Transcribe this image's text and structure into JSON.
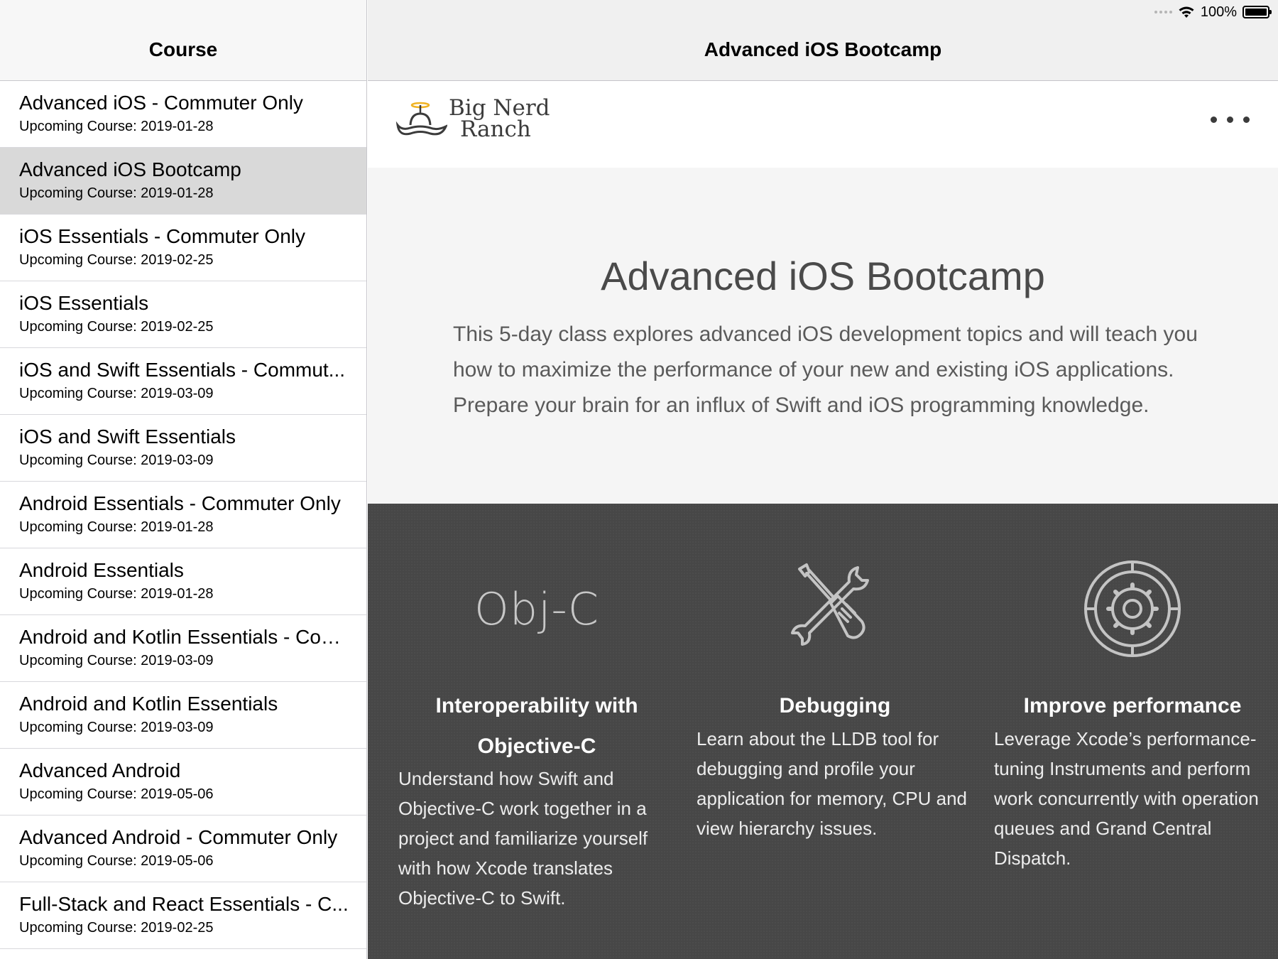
{
  "master": {
    "title": "Course",
    "courses": [
      {
        "name": "Advanced iOS - Commuter Only",
        "date": "Upcoming Course: 2019-01-28"
      },
      {
        "name": "Advanced iOS Bootcamp",
        "date": "Upcoming Course: 2019-01-28",
        "selected": true
      },
      {
        "name": "iOS Essentials - Commuter Only",
        "date": "Upcoming Course: 2019-02-25"
      },
      {
        "name": "iOS Essentials",
        "date": "Upcoming Course: 2019-02-25"
      },
      {
        "name": "iOS and Swift Essentials - Commut...",
        "date": "Upcoming Course: 2019-03-09"
      },
      {
        "name": "iOS and Swift Essentials",
        "date": "Upcoming Course: 2019-03-09"
      },
      {
        "name": "Android Essentials - Commuter Only",
        "date": "Upcoming Course: 2019-01-28"
      },
      {
        "name": "Android Essentials",
        "date": "Upcoming Course: 2019-01-28"
      },
      {
        "name": "Android and Kotlin Essentials - Com...",
        "date": "Upcoming Course: 2019-03-09"
      },
      {
        "name": "Android and Kotlin Essentials",
        "date": "Upcoming Course: 2019-03-09"
      },
      {
        "name": "Advanced Android",
        "date": "Upcoming Course: 2019-05-06"
      },
      {
        "name": "Advanced Android - Commuter Only",
        "date": "Upcoming Course: 2019-05-06"
      },
      {
        "name": "Full-Stack and React Essentials - C...",
        "date": "Upcoming Course: 2019-02-25"
      }
    ]
  },
  "status_bar": {
    "battery": "100%",
    "battery_level": 1.0,
    "icons": [
      "signal-dots-icon",
      "wifi-icon",
      "battery-icon"
    ]
  },
  "detail": {
    "nav_title": "Advanced iOS Bootcamp",
    "brand": {
      "line1": "Big Nerd",
      "line2": "Ranch",
      "icon": "cowboy-hat-propeller-icon"
    },
    "more_icon": "ellipsis-icon",
    "heading": "Advanced iOS Bootcamp",
    "description": "This 5-day class explores advanced iOS development topics and will teach you how to maximize the performance of your new and existing iOS applications. Prepare your brain for an influx of Swift and iOS programming knowledge.",
    "features": [
      {
        "icon_label": "Obj-C",
        "title_line1": "Interoperability with",
        "title_line2": "Objective-C",
        "text": "Understand how Swift and Objective-C work together in a project and familiarize yourself with how Xcode translates Objective-C to Swift."
      },
      {
        "icon": "wrench-screwdriver-icon",
        "title": "Debugging",
        "text": "Learn about the LLDB tool for debugging and profile your application for memory, CPU and view hierarchy issues."
      },
      {
        "icon": "gauge-gear-icon",
        "title": "Improve performance",
        "text": "Leverage Xcode’s performance-tuning Instruments and perform work concurrently with operation queues and Grand Central Dispatch."
      }
    ]
  },
  "colors": {
    "selected_row": "#d9d9d9",
    "features_bg": "#474747",
    "logo_accent": "#f0b323"
  }
}
